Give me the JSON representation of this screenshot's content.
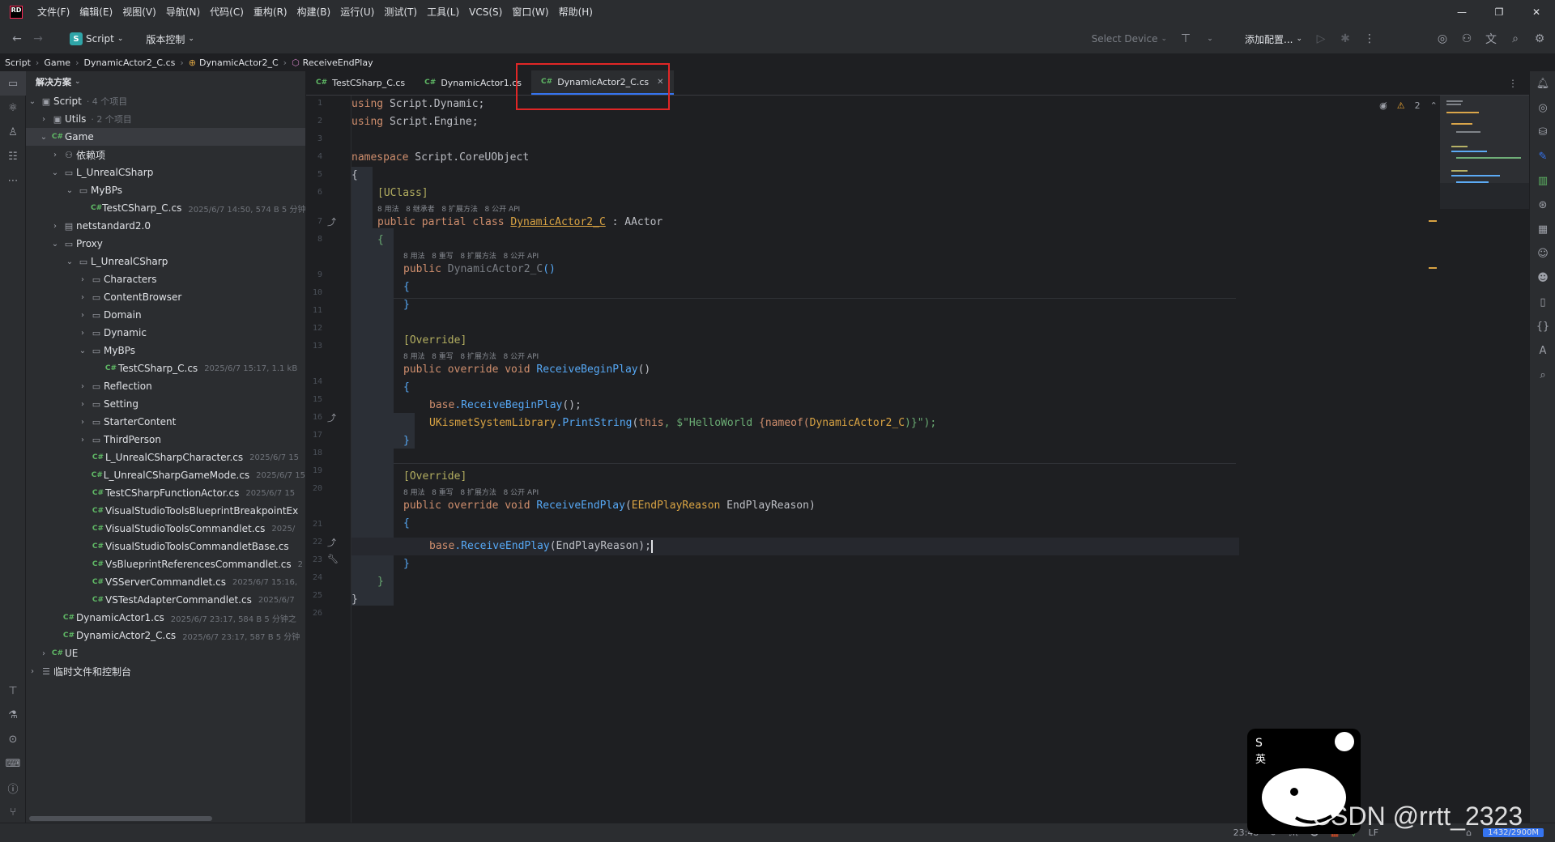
{
  "app": {
    "logo_text": "RD"
  },
  "menu": [
    "文件(F)",
    "编辑(E)",
    "视图(V)",
    "导航(N)",
    "代码(C)",
    "重构(R)",
    "构建(B)",
    "运行(U)",
    "测试(T)",
    "工具(L)",
    "VCS(S)",
    "窗口(W)",
    "帮助(H)"
  ],
  "toolbar": {
    "project_badge": "S",
    "project_name": "Script",
    "vcs_label": "版本控制",
    "device": "Select Device",
    "add_config": "添加配置..."
  },
  "breadcrumb": [
    "Script",
    "Game",
    "DynamicActor2_C.cs",
    "DynamicActor2_C",
    "ReceiveEndPlay"
  ],
  "explorer": {
    "title": "解决方案",
    "rows": [
      {
        "label": "Script",
        "extra": "· 4 个项目"
      },
      {
        "label": "Utils",
        "extra": "· 2 个项目"
      },
      {
        "label": "Game",
        "extra": ""
      },
      {
        "label": "依赖项",
        "extra": ""
      },
      {
        "label": "L_UnrealCSharp",
        "extra": ""
      },
      {
        "label": "MyBPs",
        "extra": ""
      },
      {
        "label": "TestCSharp_C.cs",
        "extra": "2025/6/7 14:50, 574 B 5 分钟"
      },
      {
        "label": "netstandard2.0",
        "extra": ""
      },
      {
        "label": "Proxy",
        "extra": ""
      },
      {
        "label": "L_UnrealCSharp",
        "extra": ""
      },
      {
        "label": "Characters",
        "extra": ""
      },
      {
        "label": "ContentBrowser",
        "extra": ""
      },
      {
        "label": "Domain",
        "extra": ""
      },
      {
        "label": "Dynamic",
        "extra": ""
      },
      {
        "label": "MyBPs",
        "extra": ""
      },
      {
        "label": "TestCSharp_C.cs",
        "extra": "2025/6/7 15:17, 1.1 kB"
      },
      {
        "label": "Reflection",
        "extra": ""
      },
      {
        "label": "Setting",
        "extra": ""
      },
      {
        "label": "StarterContent",
        "extra": ""
      },
      {
        "label": "ThirdPerson",
        "extra": ""
      },
      {
        "label": "L_UnrealCSharpCharacter.cs",
        "extra": "2025/6/7 15"
      },
      {
        "label": "L_UnrealCSharpGameMode.cs",
        "extra": "2025/6/7 15"
      },
      {
        "label": "TestCSharpFunctionActor.cs",
        "extra": "2025/6/7 15"
      },
      {
        "label": "VisualStudioToolsBlueprintBreakpointEx",
        "extra": ""
      },
      {
        "label": "VisualStudioToolsCommandlet.cs",
        "extra": "2025/"
      },
      {
        "label": "VisualStudioToolsCommandletBase.cs",
        "extra": ""
      },
      {
        "label": "VsBlueprintReferencesCommandlet.cs",
        "extra": "2"
      },
      {
        "label": "VSServerCommandlet.cs",
        "extra": "2025/6/7 15:16,"
      },
      {
        "label": "VSTestAdapterCommandlet.cs",
        "extra": "2025/6/7"
      },
      {
        "label": "DynamicActor1.cs",
        "extra": "2025/6/7 23:17, 584 B 5 分钟之"
      },
      {
        "label": "DynamicActor2_C.cs",
        "extra": "2025/6/7 23:17, 587 B 5 分钟"
      },
      {
        "label": "UE",
        "extra": ""
      },
      {
        "label": "临时文件和控制台",
        "extra": ""
      }
    ]
  },
  "tabs": [
    {
      "lang": "C#",
      "label": "TestCSharp_C.cs"
    },
    {
      "lang": "C#",
      "label": "DynamicActor1.cs"
    },
    {
      "lang": "C#",
      "label": "DynamicActor2_C.cs"
    }
  ],
  "inspection": {
    "warnings": "2"
  },
  "line_numbers": [
    "1",
    "2",
    "3",
    "4",
    "5",
    "6",
    "7",
    "8",
    "9",
    "10",
    "11",
    "12",
    "13",
    "14",
    "15",
    "16",
    "17",
    "18",
    "19",
    "20",
    "21",
    "22",
    "23",
    "24",
    "25",
    "26"
  ],
  "code": {
    "l1_kw": "using",
    "l1_rest": " Script.Dynamic;",
    "l2_kw": "using",
    "l2_rest": " Script.Engine;",
    "l4_kw": "namespace",
    "l4_rest": " Script.CoreUObject",
    "l5": "{",
    "l6": "[UClass]",
    "hint_class": "8 用法   8 继承者   8 扩展方法   8 公开 API",
    "l7_kw": "public partial class",
    "l7_name": "DynamicActor2_C",
    "l7_rest": " : AActor",
    "l8": "{",
    "hint_ctor": "8 用法   8 重写   8 扩展方法   8 公开 API",
    "l9_kw": "public",
    "l9_name": " DynamicActor2_C",
    "l9_rest": "()",
    "l10": "{",
    "l11": "}",
    "l13": "[Override]",
    "hint_begin": "8 用法   8 重写   8 扩展方法   8 公开 API",
    "l14_kw": "public override void",
    "l14_name": " ReceiveBeginPlay",
    "l14_rest": "()",
    "l15": "{",
    "l16_base": "base",
    "l16_meth": ".ReceiveBeginPlay",
    "l16_rest": "();",
    "l17_cls": "UKismetSystemLibrary",
    "l17_meth": ".PrintString",
    "l17_a": "(",
    "l17_this": "this",
    "l17_str": ", $\"HelloWorld ",
    "l17_nameof": "{nameof(",
    "l17_ref": "DynamicActor2_C",
    "l17_end": ")}\");",
    "l18": "}",
    "l20": "[Override]",
    "hint_end": "8 用法   8 重写   8 扩展方法   8 公开 API",
    "l21_kw": "public override void",
    "l21_name": " ReceiveEndPlay",
    "l21_paren": "(",
    "l21_type": "EEndPlayReason",
    "l21_param": " EndPlayReason",
    "l21_close": ")",
    "l22": "{",
    "l23_base": "base",
    "l23_meth": ".ReceiveEndPlay",
    "l23_rest": "(EndPlayReason);",
    "l24": "}",
    "l25": "}",
    "l26": "}"
  },
  "status": {
    "position": "23:48",
    "line_sep": "LF",
    "memory": "1432/2900M"
  },
  "watermark": "CSDN @rrtt_2323"
}
